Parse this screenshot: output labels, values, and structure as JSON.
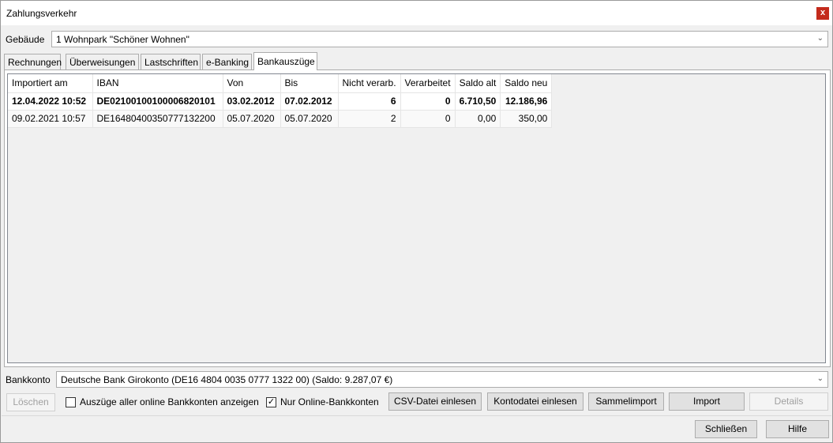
{
  "window": {
    "title": "Zahlungsverkehr",
    "close_label": "x"
  },
  "building": {
    "label": "Gebäude",
    "value": "1 Wohnpark \"Schöner Wohnen\""
  },
  "tabs": [
    {
      "label": "Rechnungen"
    },
    {
      "label": "Überweisungen"
    },
    {
      "label": "Lastschriften"
    },
    {
      "label": "e-Banking"
    },
    {
      "label": "Bankauszüge"
    }
  ],
  "active_tab": "Bankauszüge",
  "table": {
    "columns": [
      "Importiert am",
      "IBAN",
      "Von",
      "Bis",
      "Nicht verarb.",
      "Verarbeitet",
      "Saldo alt",
      "Saldo neu"
    ],
    "rows": [
      [
        "12.04.2022 10:52",
        "DE02100100100006820101",
        "03.02.2012",
        "07.02.2012",
        "6",
        "0",
        "6.710,50",
        "12.186,96"
      ],
      [
        "09.02.2021 10:57",
        "DE16480400350777132200",
        "05.07.2020",
        "05.07.2020",
        "2",
        "0",
        "0,00",
        "350,00"
      ]
    ]
  },
  "bank_account": {
    "label": "Bankkonto",
    "value": "Deutsche Bank Girokonto (DE16 4804 0035 0777 1322 00) (Saldo: 9.287,07 €)"
  },
  "actions": {
    "delete_label": "Löschen",
    "show_all_label": "Auszüge aller online Bankkonten anzeigen",
    "show_all_checked": false,
    "online_only_label": "Nur Online-Bankkonten",
    "online_only_checked": true,
    "csv_label": "CSV-Datei einlesen",
    "account_file_label": "Kontodatei einlesen",
    "bulk_import_label": "Sammelimport",
    "import_label": "Import",
    "details_label": "Details"
  },
  "footer": {
    "close_label": "Schließen",
    "help_label": "Hilfe"
  },
  "icons": {
    "close": "close-icon",
    "dropdown": "chevron-down-icon",
    "check": "check-icon"
  }
}
